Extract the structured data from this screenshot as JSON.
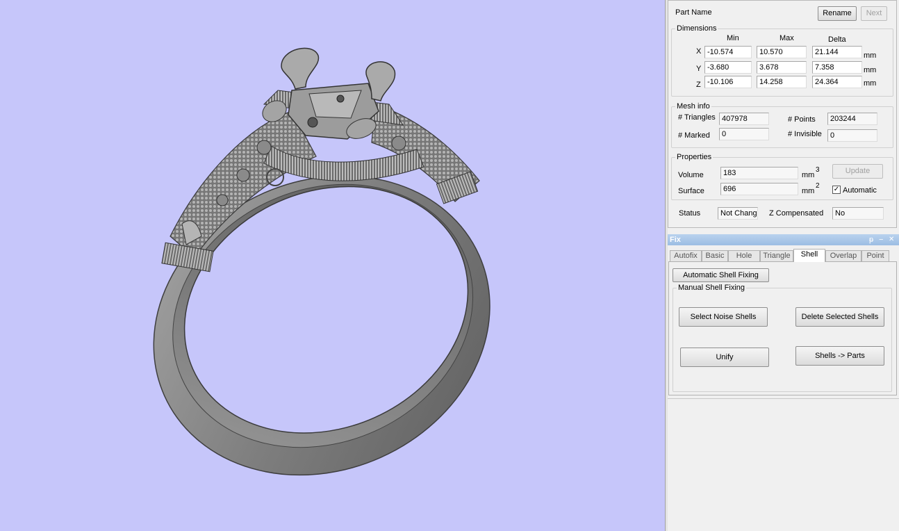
{
  "colors": {
    "viewport_background": "#c6c6fa",
    "model_color": "#8a8a8a",
    "fix_titlebar": "#9cbde3"
  },
  "viewport": {
    "model": "ring"
  },
  "part": {
    "name_label": "Part Name",
    "rename_button": "Rename",
    "next_button": "Next"
  },
  "dimensions": {
    "title": "Dimensions",
    "col_min": "Min",
    "col_max": "Max",
    "col_delta": "Delta",
    "unit": "mm",
    "rows": [
      {
        "axis": "X",
        "min": "-10.574",
        "max": "10.570",
        "delta": "21.144"
      },
      {
        "axis": "Y",
        "min": "-3.680",
        "max": "3.678",
        "delta": "7.358"
      },
      {
        "axis": "Z",
        "min": "-10.106",
        "max": "14.258",
        "delta": "24.364"
      }
    ]
  },
  "mesh_info": {
    "title": "Mesh info",
    "triangles_label": "# Triangles",
    "triangles": "407978",
    "points_label": "# Points",
    "points": "203244",
    "marked_label": "# Marked",
    "marked": "0",
    "invisible_label": "# Invisible",
    "invisible": "0"
  },
  "properties": {
    "title": "Properties",
    "volume_label": "Volume",
    "volume": "183",
    "volume_unit": "mm",
    "volume_exp": "3",
    "surface_label": "Surface",
    "surface": "696",
    "surface_unit": "mm",
    "surface_exp": "2",
    "update_button": "Update",
    "automatic_label": "Automatic",
    "automatic_checked": true,
    "check_mark": "✓"
  },
  "status": {
    "label": "Status",
    "value": "Not Changed",
    "z_label": "Z Compensated",
    "z_value": "No"
  },
  "fix_panel": {
    "title": "Fix",
    "pin_glyph": "ᵽ",
    "min_glyph": "−",
    "close_glyph": "✕",
    "tabs": [
      "Autofix",
      "Basic",
      "Hole",
      "Triangle",
      "Shell",
      "Overlap",
      "Point"
    ],
    "active_tab": "Shell",
    "auto_button": "Automatic Shell Fixing",
    "manual_title": "Manual Shell Fixing",
    "select_noise": "Select Noise Shells",
    "delete_selected": "Delete Selected Shells",
    "unify": "Unify",
    "shells_to_parts": "Shells -> Parts"
  }
}
